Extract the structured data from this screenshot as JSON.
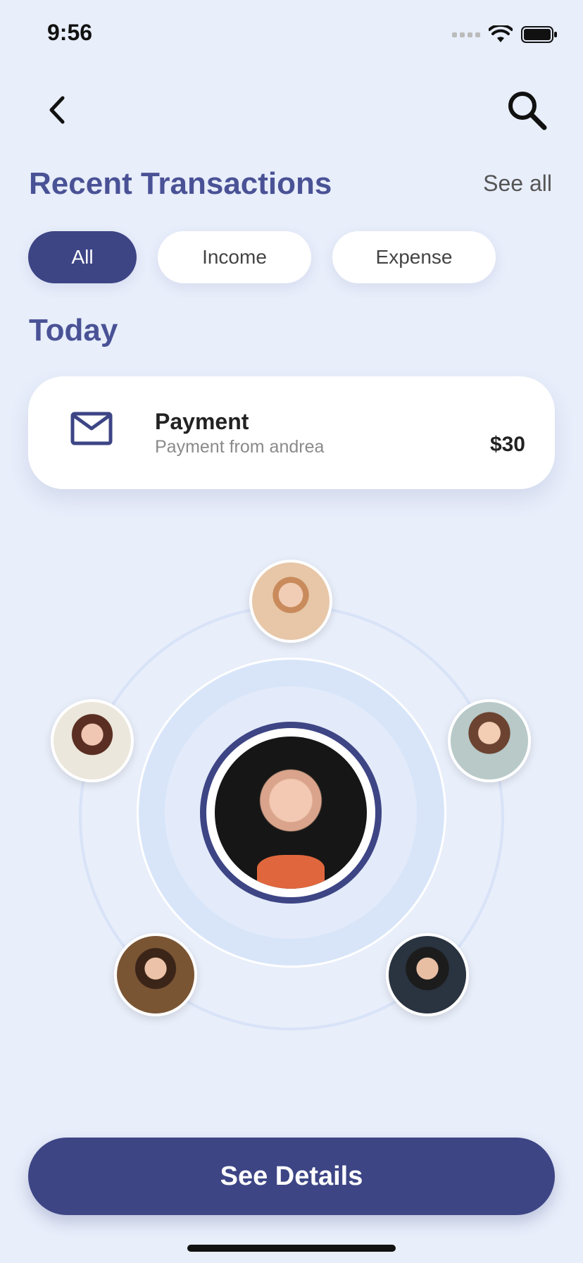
{
  "status_bar": {
    "time": "9:56"
  },
  "header": {
    "back_icon": "chevron-left-icon",
    "search_icon": "search-icon"
  },
  "section": {
    "title": "Recent Transactions",
    "see_all": "See all"
  },
  "filters": [
    {
      "label": "All",
      "active": true
    },
    {
      "label": "Income",
      "active": false
    },
    {
      "label": "Expense",
      "active": false
    }
  ],
  "group_label": "Today",
  "transaction": {
    "icon": "mail-icon",
    "title": "Payment",
    "subtitle": "Payment from andrea",
    "amount": "$30"
  },
  "contacts": {
    "center": "avatar-center",
    "around": [
      "avatar-top",
      "avatar-left",
      "avatar-right",
      "avatar-bottom-left",
      "avatar-bottom-right"
    ]
  },
  "actions": {
    "primary_label": "See Details"
  },
  "colors": {
    "accent": "#3d4585",
    "heading": "#4a5296",
    "background": "#e8eefa"
  }
}
